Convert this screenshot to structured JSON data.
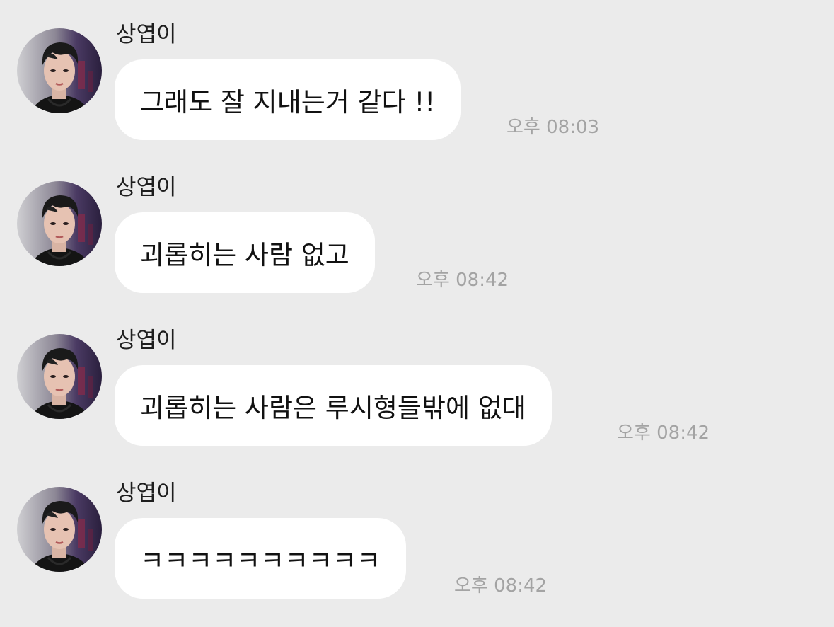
{
  "messages": [
    {
      "sender": "상엽이",
      "text": "그래도 잘 지내는거 같다 !!",
      "time": "오후 08:03"
    },
    {
      "sender": "상엽이",
      "text": "괴롭히는 사람 없고",
      "time": "오후 08:42"
    },
    {
      "sender": "상엽이",
      "text": "괴롭히는 사람은 루시형들밖에 없대",
      "time": "오후 08:42"
    },
    {
      "sender": "상엽이",
      "text": "ㅋㅋㅋㅋㅋㅋㅋㅋㅋㅋ",
      "time": "오후 08:42"
    }
  ],
  "colors": {
    "background": "#ebebeb",
    "bubble": "#ffffff",
    "timestamp": "#a3a3a3"
  }
}
